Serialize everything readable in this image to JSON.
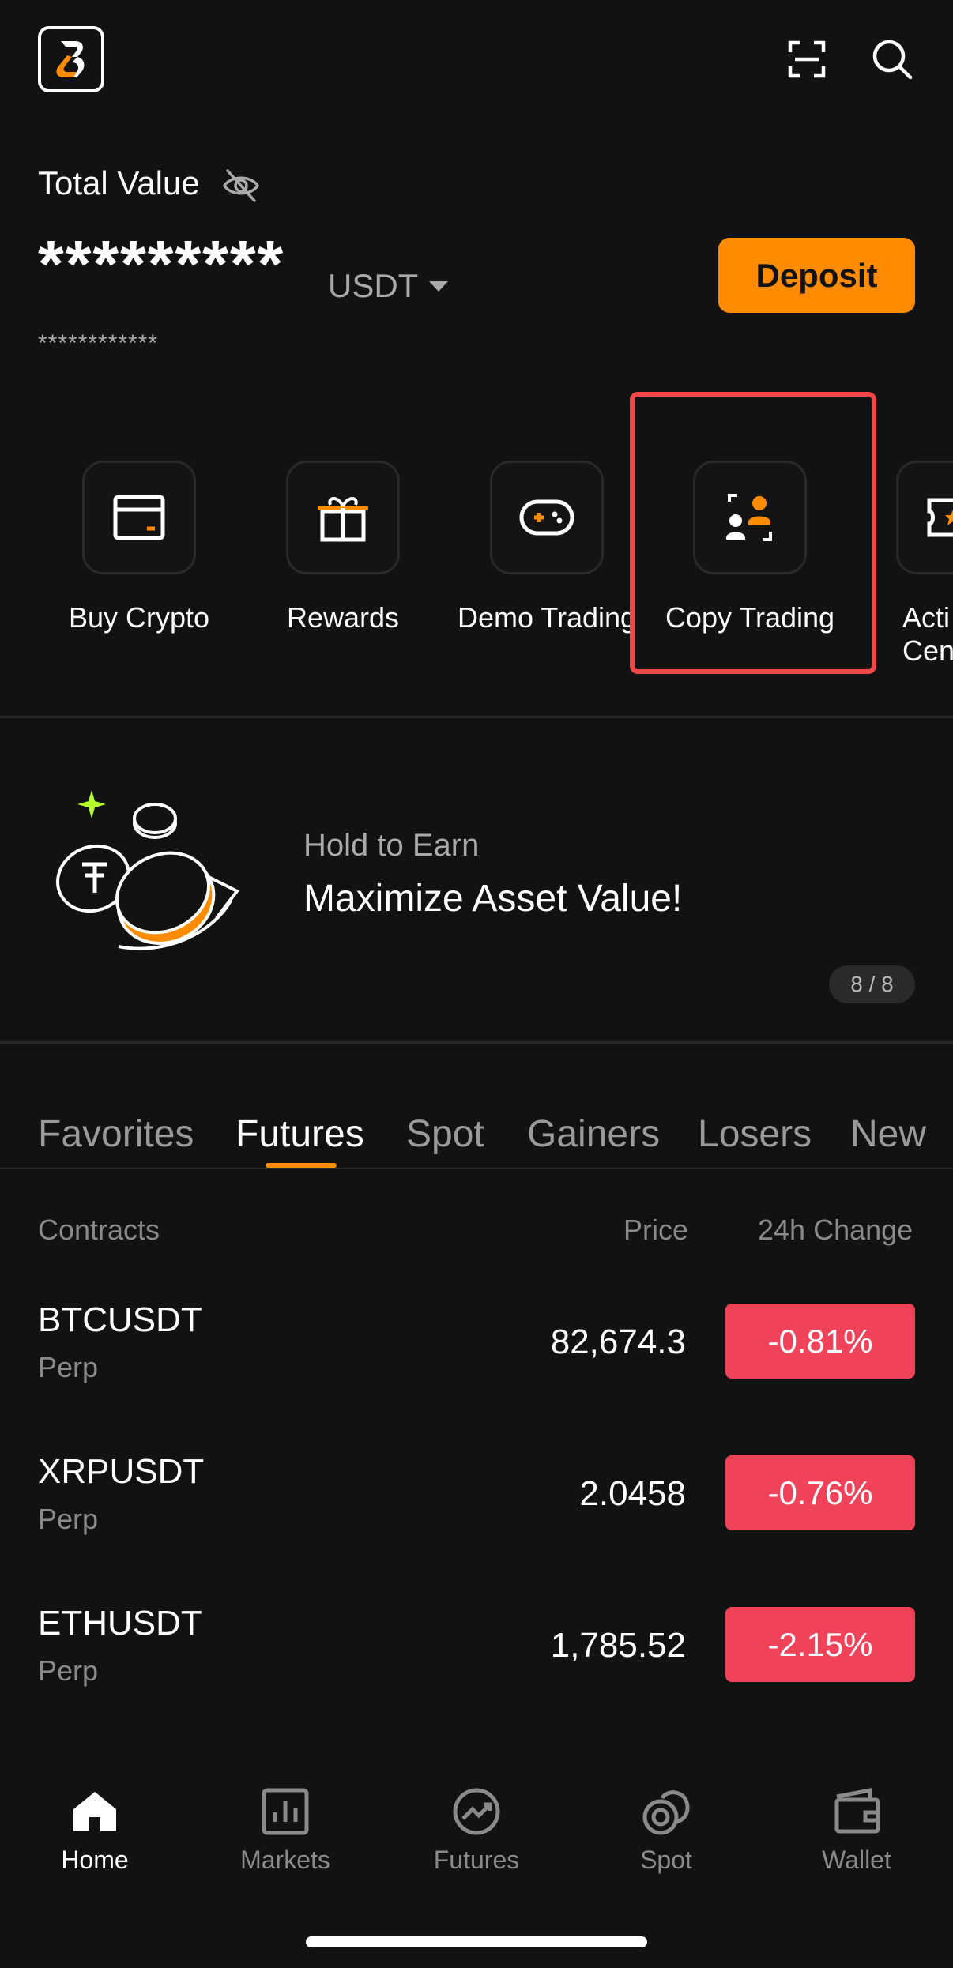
{
  "header": {
    "logo_icon": "bitget-logo",
    "scan_icon": "scan-icon",
    "search_icon": "search-icon"
  },
  "account": {
    "total_value_label": "Total Value",
    "masked_value": "*********",
    "currency": "USDT",
    "masked_secondary": "************",
    "deposit_label": "Deposit"
  },
  "quick_actions": [
    {
      "label": "Buy Crypto",
      "icon": "card-icon"
    },
    {
      "label": "Rewards",
      "icon": "gift-icon"
    },
    {
      "label": "Demo Trading",
      "icon": "gamepad-icon"
    },
    {
      "label": "Copy Trading",
      "icon": "copy-trading-icon"
    },
    {
      "label": "Acti Cen",
      "icon": "ticket-icon"
    }
  ],
  "banner": {
    "subtitle": "Hold to Earn",
    "title": "Maximize Asset Value!",
    "pager": "8 / 8"
  },
  "market_tabs": [
    "Favorites",
    "Futures",
    "Spot",
    "Gainers",
    "Losers",
    "New"
  ],
  "active_tab": "Futures",
  "table": {
    "headers": {
      "contracts": "Contracts",
      "price": "Price",
      "change": "24h Change"
    },
    "rows": [
      {
        "symbol": "BTCUSDT",
        "type": "Perp",
        "price": "82,674.3",
        "change": "-0.81%"
      },
      {
        "symbol": "XRPUSDT",
        "type": "Perp",
        "price": "2.0458",
        "change": "-0.76%"
      },
      {
        "symbol": "ETHUSDT",
        "type": "Perp",
        "price": "1,785.52",
        "change": "-2.15%"
      }
    ]
  },
  "bottom_nav": [
    {
      "label": "Home",
      "icon": "home-icon"
    },
    {
      "label": "Markets",
      "icon": "markets-icon"
    },
    {
      "label": "Futures",
      "icon": "futures-icon"
    },
    {
      "label": "Spot",
      "icon": "spot-icon"
    },
    {
      "label": "Wallet",
      "icon": "wallet-icon"
    }
  ],
  "colors": {
    "background": "#121212",
    "accent": "#ff8c00",
    "negative": "#f0435a",
    "highlight": "#f04848"
  }
}
